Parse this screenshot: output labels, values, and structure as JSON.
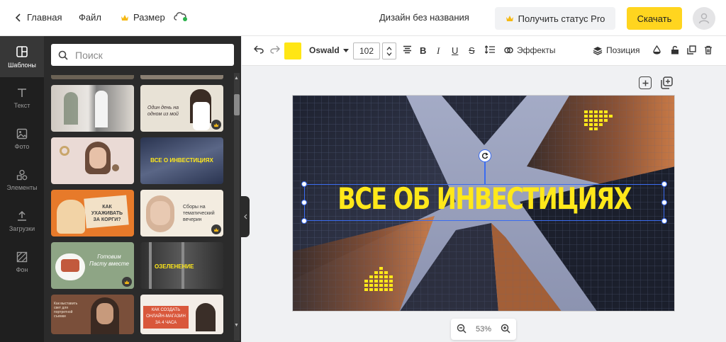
{
  "topbar": {
    "home": "Главная",
    "file": "Файл",
    "size": "Размер",
    "title": "Дизайн без названия",
    "pro": "Получить статус Pro",
    "download": "Скачать"
  },
  "nav": [
    "Шаблоны",
    "Текст",
    "Фото",
    "Элементы",
    "Загрузки",
    "Фон"
  ],
  "search": {
    "placeholder": "Поиск"
  },
  "thumbs": [
    {
      "text": "",
      "bg": "#d9d6d0"
    },
    {
      "text": "Один день на одном из мой",
      "bg": "#e8e2d6"
    },
    {
      "text": "",
      "bg": "#e9d8d3"
    },
    {
      "text": "ВСЕ О ИНВЕСТИЦИЯХ",
      "bg": "#44506a"
    },
    {
      "text": "КАК УХАЖИВАТЬ ЗА КОРГИ?",
      "bg": "#e77a2a"
    },
    {
      "text": "Сборы на тематический вечерин",
      "bg": "#f3ece0"
    },
    {
      "text": "Готовим Пасту вместе",
      "bg": "#8ea585"
    },
    {
      "text": "ОЗЕЛЕНЕНИЕ",
      "bg": "#3a3a3a"
    },
    {
      "text": "Как выставить свет для портретной съемки",
      "bg": "#7a4f3a"
    },
    {
      "text": "КАК СОЗДАТЬ ОНЛАЙН-МАГАЗИН ЗА 4 ЧАСА",
      "bg": "#f3ede7"
    }
  ],
  "toolbar": {
    "font": "Oswald",
    "font_size": "102",
    "effects": "Эффекты",
    "position": "Позиция"
  },
  "canvas": {
    "headline": "ВСЕ ОБ ИНВЕСТИЦИЯХ"
  },
  "zoom": {
    "level": "53%"
  },
  "colors": {
    "accent": "#ffd51f",
    "text_yellow": "#ffe81a",
    "selection": "#3b6cf0"
  }
}
